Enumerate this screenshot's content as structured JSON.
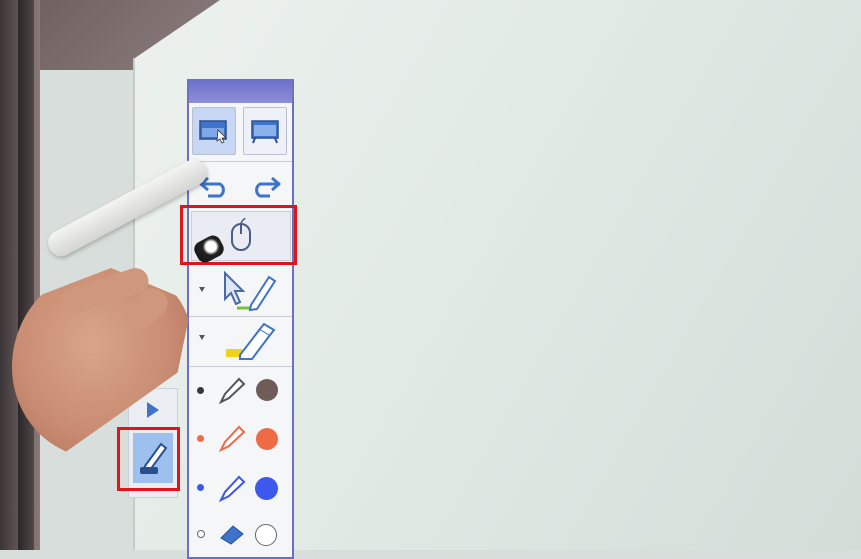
{
  "toolbar": {
    "modes": [
      {
        "icon": "window-cursor-icon",
        "active": true
      },
      {
        "icon": "fullscreen-board-icon",
        "active": false
      }
    ],
    "history": [
      {
        "icon": "undo-icon"
      },
      {
        "icon": "redo-icon"
      }
    ],
    "mouse_tool": {
      "icon": "mouse-icon",
      "highlighted": true
    },
    "tools": [
      {
        "icon": "cursor-pen-icon",
        "dot_color": "#78c23a"
      },
      {
        "icon": "highlighter-icon",
        "dot_color": "#f0d21c"
      }
    ],
    "pens": [
      {
        "icon": "pen-icon",
        "color": "#6d5c58"
      },
      {
        "icon": "pen-icon",
        "color": "#ef6a46"
      },
      {
        "icon": "pen-icon",
        "color": "#3c58ee"
      },
      {
        "icon": "eraser-icon",
        "color": "#ffffff"
      }
    ],
    "header_color": "#6b6fc9"
  },
  "mini_panel": {
    "expand_icon": "play-triangle-icon",
    "pen_mode_icon": "pen-tray-icon",
    "highlighted": true
  },
  "colors": {
    "highlight": "#e0151b",
    "accent": "#3e73c9"
  }
}
